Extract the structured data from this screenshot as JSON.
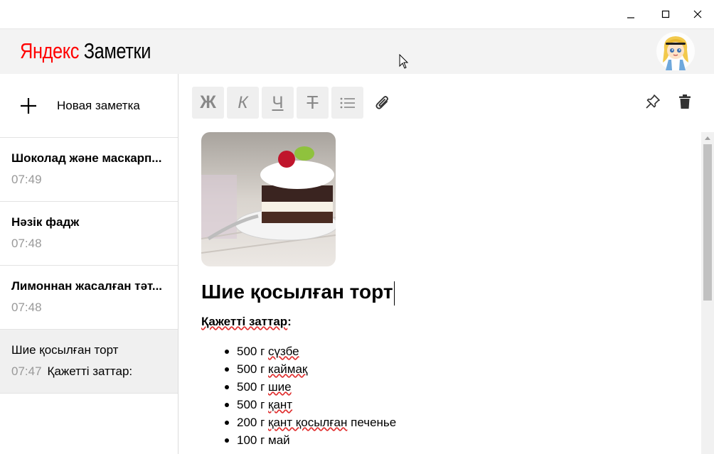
{
  "window": {
    "minimize_icon": "minimize-icon",
    "maximize_icon": "maximize-icon",
    "close_icon": "close-icon"
  },
  "header": {
    "logo_brand": "Яндекс",
    "logo_product": "Заметки",
    "brand_color": "#ff0000",
    "avatar_icon": "user-avatar"
  },
  "sidebar": {
    "new_note_label": "Новая заметка",
    "new_note_icon": "plus-icon",
    "notes": [
      {
        "title": "Шоколад және маскарп...",
        "time": "07:49",
        "snippet": ""
      },
      {
        "title": "Нәзік фадж",
        "time": "07:48",
        "snippet": ""
      },
      {
        "title": "Лимоннан жасалған тәт...",
        "time": "07:48",
        "snippet": ""
      },
      {
        "title": "Шие қосылған торт",
        "time": "07:47",
        "snippet": "Қажетті заттар:",
        "active": true
      }
    ]
  },
  "toolbar": {
    "bold": "Ж",
    "italic": "К",
    "underline": "Ч",
    "strike": "Т",
    "list_icon": "bulleted-list-icon",
    "attach_icon": "paperclip-icon",
    "pin_icon": "pin-icon",
    "trash_icon": "trash-icon"
  },
  "note": {
    "image_icon": "cake-photo",
    "heading": "Шие қосылған торт",
    "section_title": "Қажетті заттар",
    "section_colon": ":",
    "ingredients": [
      {
        "qty": "500 г ",
        "item": "сүзбе",
        "rest": ""
      },
      {
        "qty": "500 г ",
        "item": "каймақ",
        "rest": ""
      },
      {
        "qty": "500 г ",
        "item": "шие",
        "rest": ""
      },
      {
        "qty": "500 г ",
        "item": "қант",
        "rest": ""
      },
      {
        "qty": "200 г ",
        "item": "қант қосылған",
        "rest": " печенье"
      },
      {
        "qty": "100 г ",
        "item": "май",
        "rest": ""
      }
    ]
  }
}
